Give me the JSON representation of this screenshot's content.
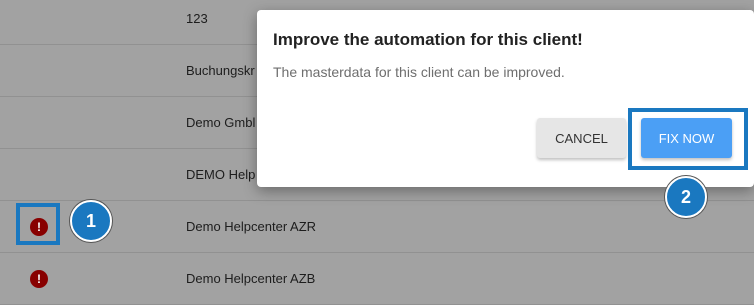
{
  "table": {
    "rows": [
      {
        "name": "123",
        "warning": false
      },
      {
        "name": "Buchungskr",
        "warning": false
      },
      {
        "name": "Demo Gmbl",
        "warning": false
      },
      {
        "name": "DEMO Help",
        "warning": false
      },
      {
        "name": "Demo Helpcenter AZR",
        "warning": true
      },
      {
        "name": "Demo Helpcenter AZB",
        "warning": true
      }
    ]
  },
  "warning_icon_glyph": "!",
  "modal": {
    "title": "Improve the automation for this client!",
    "body": "The masterdata for this client can be improved.",
    "cancel_label": "CANCEL",
    "fix_label": "FIX NOW"
  },
  "annotations": {
    "badge1": "1",
    "badge2": "2"
  },
  "colors": {
    "backdrop": "#a6a6a6",
    "primary": "#4b9ff5",
    "highlight": "#1a78c0",
    "warning": "#8b0000"
  }
}
